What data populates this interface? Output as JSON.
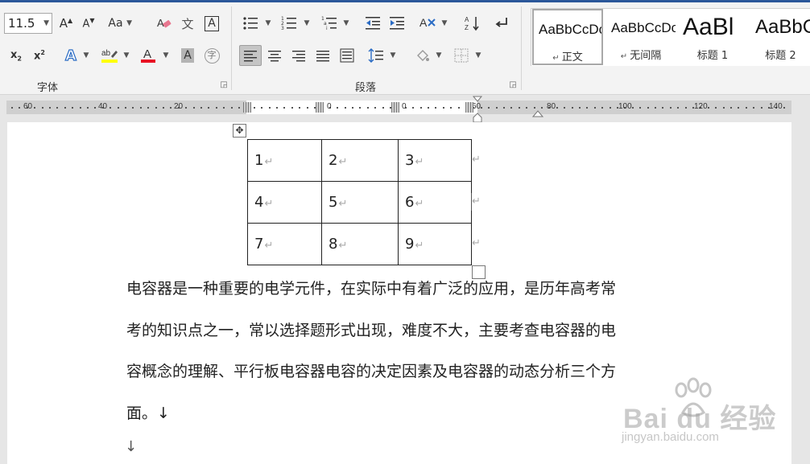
{
  "ribbon": {
    "font_group": {
      "label": "字体",
      "font_size": "11.5",
      "change_case": "Aa",
      "phonetic_guide": "文"
    },
    "paragraph_group": {
      "label": "段落"
    },
    "styles_group": {
      "items": [
        {
          "sample": "AaBbCcDc",
          "name": "正文"
        },
        {
          "sample": "AaBbCcDc",
          "name": "无间隔"
        },
        {
          "sample": "AaBl",
          "name": "标题 1"
        },
        {
          "sample": "AaBbC",
          "name": "标题 2"
        }
      ]
    }
  },
  "ruler": {
    "labels": [
      "60",
      "40",
      "20",
      "0",
      "0",
      "60",
      "80",
      "100",
      "120",
      "140"
    ]
  },
  "document": {
    "table": [
      [
        "1",
        "2",
        "3"
      ],
      [
        "4",
        "5",
        "6"
      ],
      [
        "7",
        "8",
        "9"
      ]
    ],
    "paragraph_mark": "↵",
    "body_lines": [
      "电容器是一种重要的电学元件，在实际中有着广泛的应用，是历年高考常",
      "考的知识点之一，常以选择题形式出现，难度不大，主要考查电容器的电",
      "容概念的理解、平行板电容器电容的决定因素及电容器的动态分析三个方",
      "面。↓"
    ],
    "empty_line": "↓"
  },
  "watermark": {
    "logo": "Bai  du 经验",
    "url": "jingyan.baidu.com"
  },
  "colors": {
    "accent": "#2b579a",
    "highlight_yellow": "#ffff00",
    "font_color_red": "#e81123"
  }
}
